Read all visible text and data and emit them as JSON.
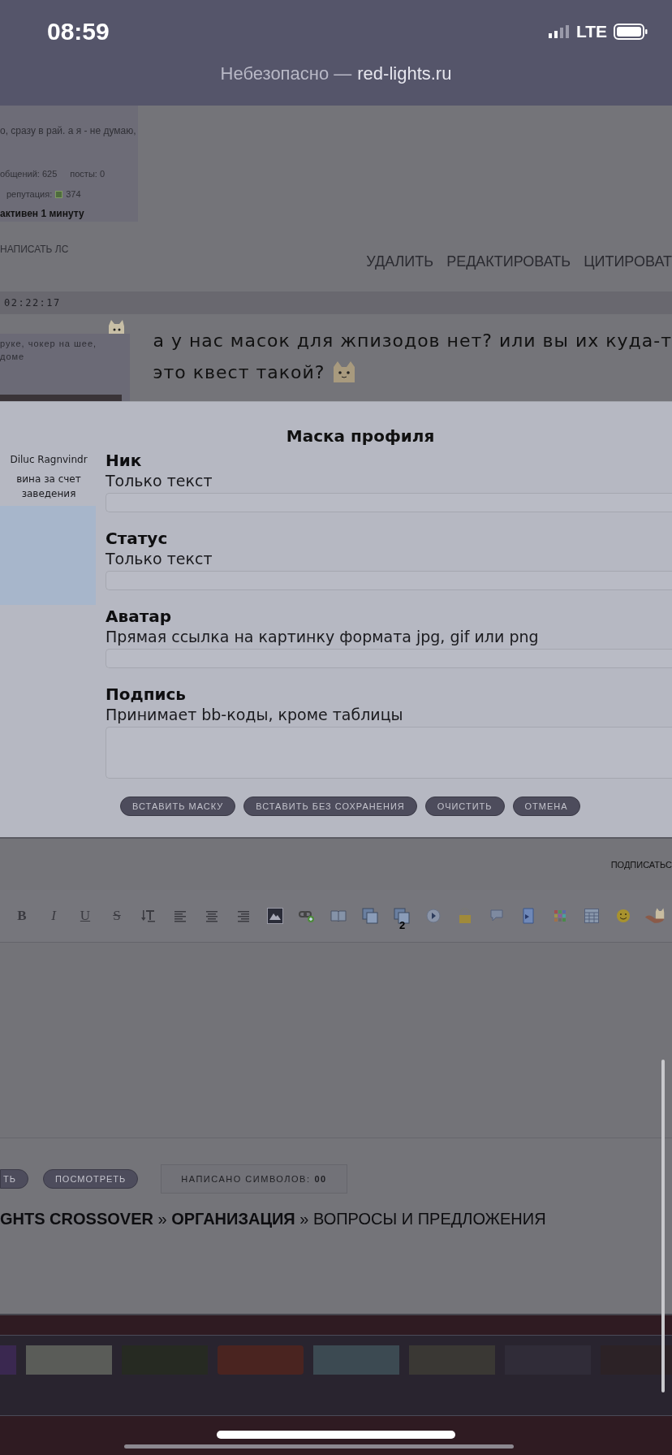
{
  "status_bar": {
    "time": "08:59",
    "network": "LTE"
  },
  "address_bar": {
    "security": "Небезопасно —",
    "domain": "red-lights.ru"
  },
  "profile_card": {
    "quote": "о, сразу в рай. а я - не думаю,",
    "messages": "общений: 625",
    "posts": "посты: 0",
    "reputation_label": "репутация:",
    "reputation": "374",
    "activity": "активен 1 минуту"
  },
  "post_actions": {
    "message_link": "НАПИСАТЬ ЛС",
    "actions": [
      "УДАЛИТЬ",
      "РЕДАКТИРОВАТЬ",
      "ЦИТИРОВАТ"
    ]
  },
  "post": {
    "time": "02:22:17",
    "author_lines": [
      "руке, чокер на шее,",
      "доме"
    ],
    "text_lines": [
      "а у нас масок для жпизодов нет? или вы их куда-т",
      "это квест такой?"
    ]
  },
  "modal": {
    "title": "Маска профиля",
    "preview": {
      "name": "Diluc Ragnvindr",
      "status": "вина за счет заведения"
    },
    "fields": [
      {
        "label": "Ник",
        "hint": "Только текст",
        "kind": "line"
      },
      {
        "label": "Статус",
        "hint": "Только текст",
        "kind": "line"
      },
      {
        "label": "Аватар",
        "hint": "Прямая ссылка на картинку формата jpg, gif или png",
        "kind": "line"
      },
      {
        "label": "Подпись",
        "hint": "Принимает bb-коды, кроме таблицы",
        "kind": "area"
      }
    ],
    "buttons": [
      "ВСТАВИТЬ МАСКУ",
      "ВСТАВИТЬ БЕЗ СОХРАНЕНИЯ",
      "ОЧИСТИТЬ",
      "ОТМЕНА"
    ]
  },
  "subscribe_link": "ПОДПИСАТЬС",
  "toolbar": [
    {
      "kind": "bold",
      "label": "B"
    },
    {
      "kind": "italic",
      "label": "I"
    },
    {
      "kind": "underline",
      "label": "U"
    },
    {
      "kind": "strike",
      "label": "S"
    },
    {
      "kind": "text-size"
    },
    {
      "kind": "align-left"
    },
    {
      "kind": "align-center"
    },
    {
      "kind": "align-right"
    },
    {
      "kind": "image"
    },
    {
      "kind": "link"
    },
    {
      "kind": "book"
    },
    {
      "kind": "windows"
    },
    {
      "kind": "windows-numbered",
      "label": "2"
    },
    {
      "kind": "play"
    },
    {
      "kind": "lock"
    },
    {
      "kind": "speech"
    },
    {
      "kind": "document"
    },
    {
      "kind": "palette"
    },
    {
      "kind": "table"
    },
    {
      "kind": "smiley"
    },
    {
      "kind": "sticker"
    }
  ],
  "form_buttons": [
    "ТЬ",
    "ПОСМОТРЕТЬ"
  ],
  "char_counter": {
    "label": "НАПИСАНО СИМВОЛОВ:",
    "value": "00"
  },
  "breadcrumbs": "**GHTS CROSSOVER** » **ОРГАНИЗАЦИЯ** » ВОПРОСЫ И ПРЕДЛОЖЕНИЯ"
}
